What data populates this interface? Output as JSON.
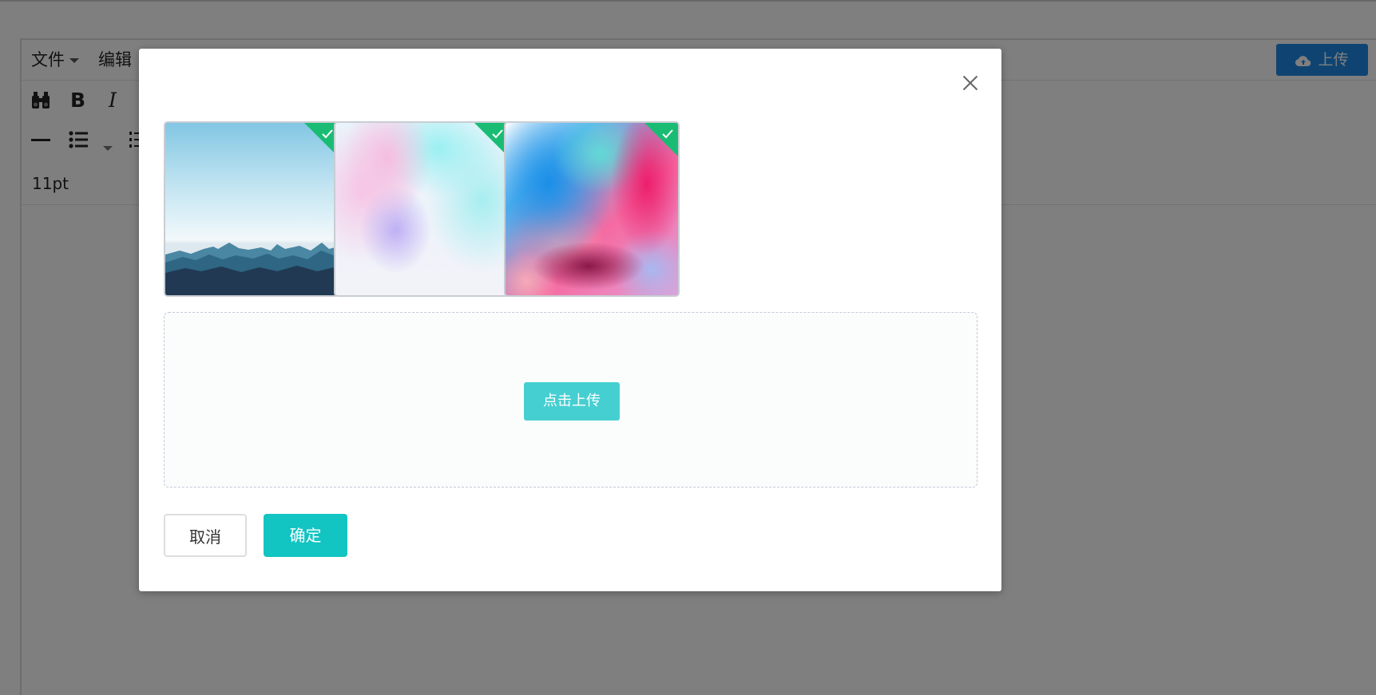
{
  "editor": {
    "menu": [
      {
        "label": "文件",
        "has_caret": true
      },
      {
        "label": "编辑",
        "has_caret": false
      }
    ],
    "upload_button_label": "上传",
    "font_size_value": "11pt"
  },
  "modal": {
    "images": [
      {
        "selected": true,
        "description": "mountain-landscape"
      },
      {
        "selected": true,
        "description": "pastel-blur"
      },
      {
        "selected": true,
        "description": "abstract-paint"
      }
    ],
    "dropzone_button_label": "点击上传",
    "cancel_label": "取消",
    "confirm_label": "确定"
  },
  "colors": {
    "accent": "#12c4c2",
    "dropzone_button": "#46cfd1",
    "badge_green": "#1abc74",
    "top_upload_blue": "#1e88e5"
  }
}
